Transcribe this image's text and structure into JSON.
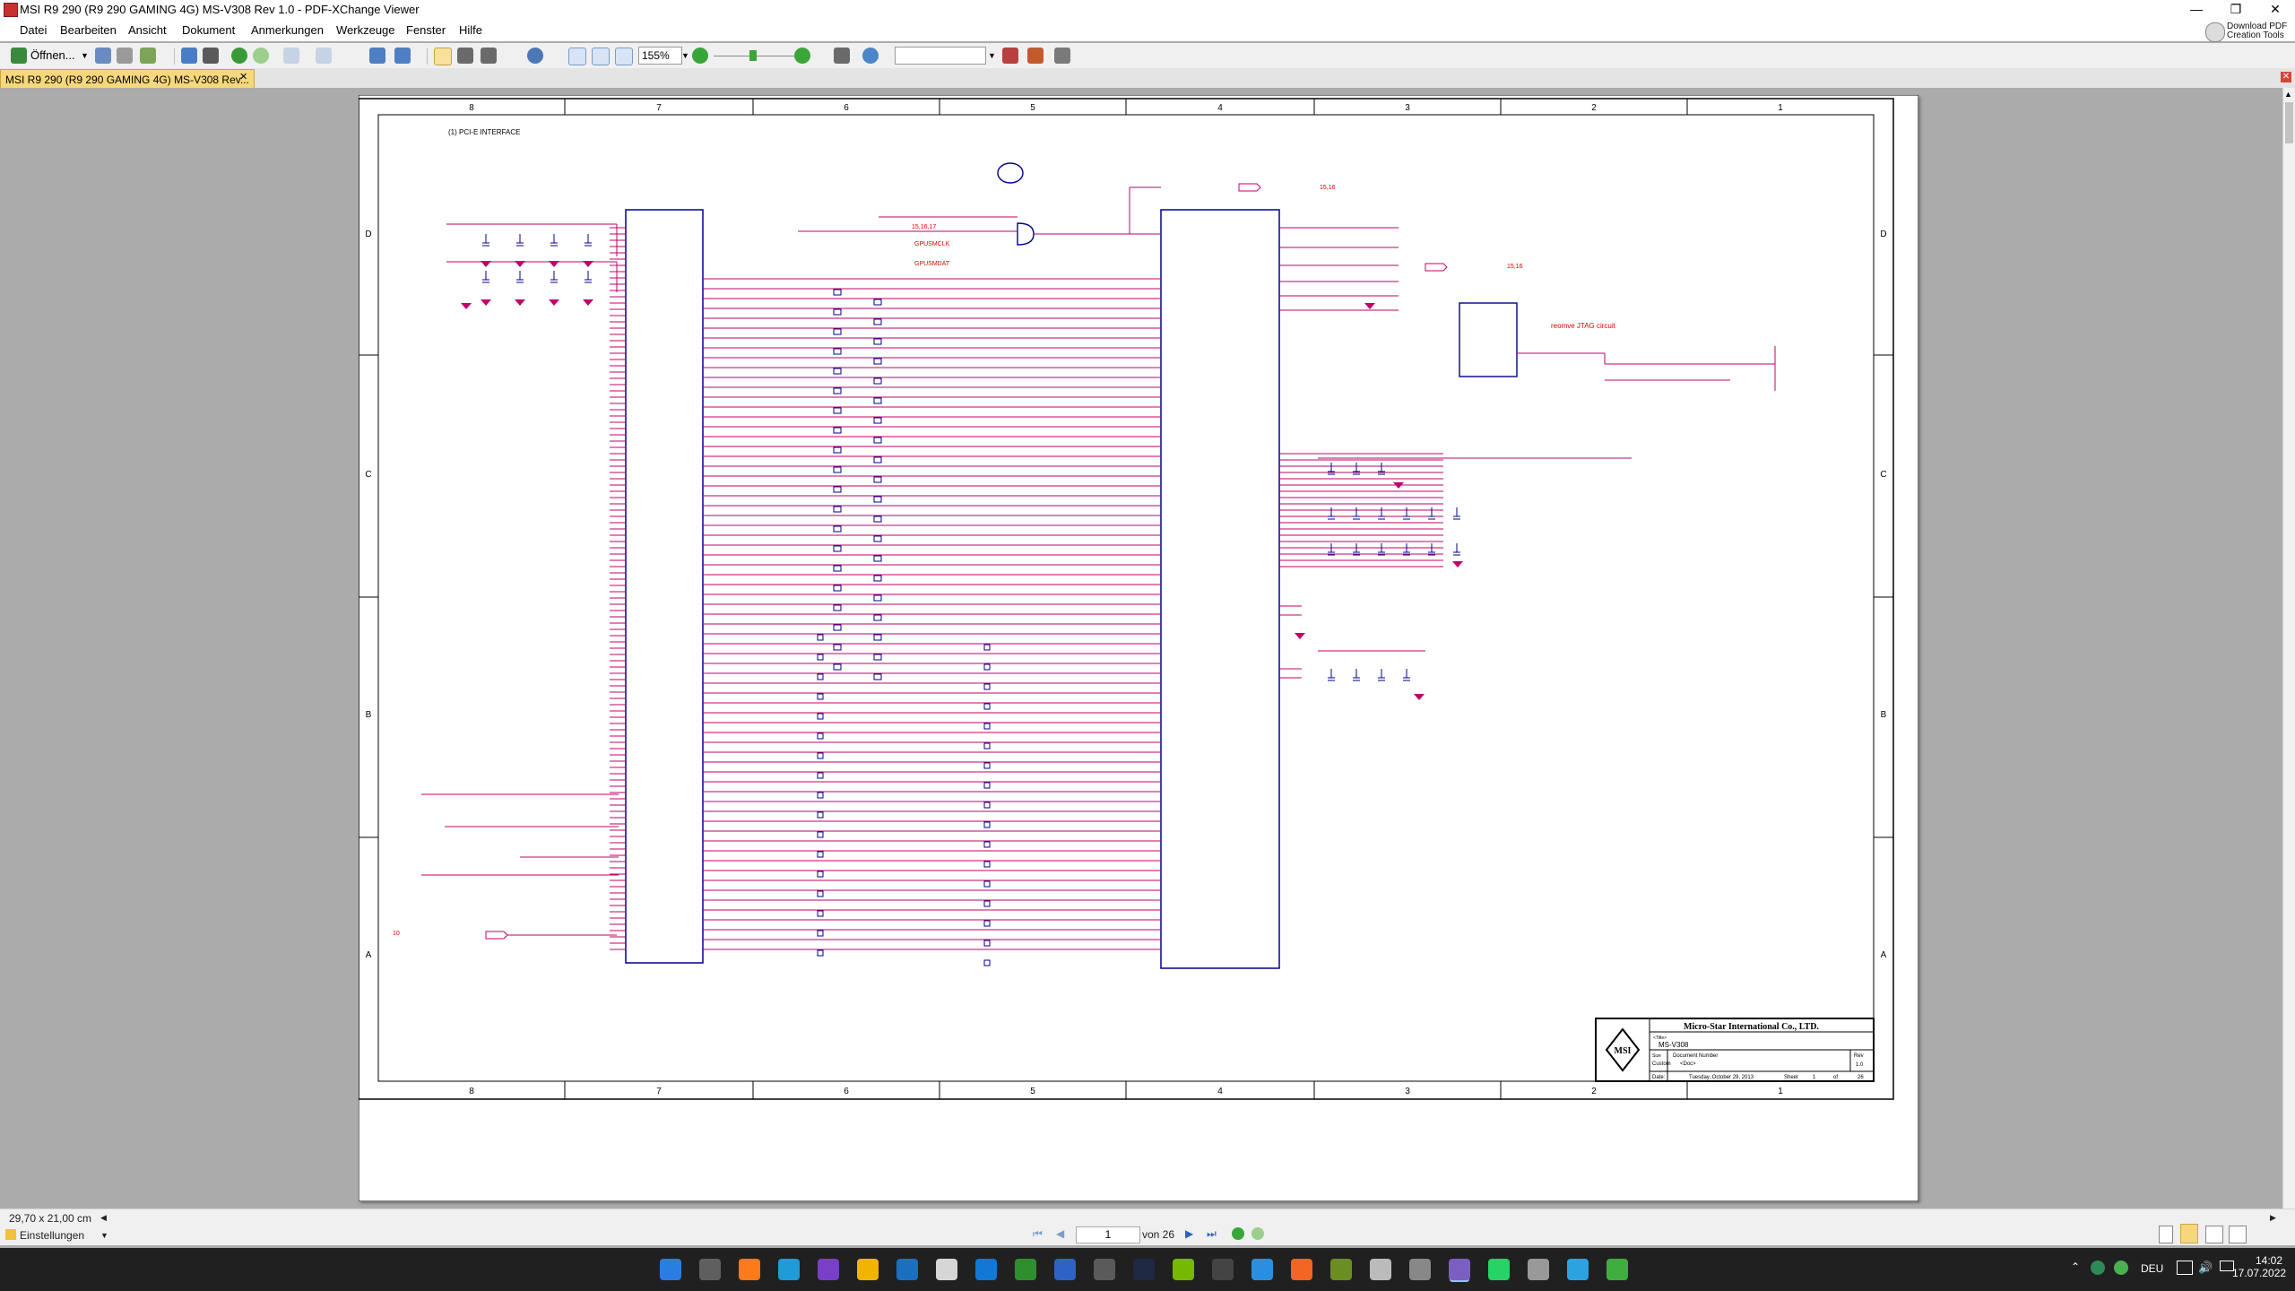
{
  "window": {
    "title": "MSI R9 290 (R9 290 GAMING 4G) MS-V308 Rev 1.0 - PDF-XChange Viewer",
    "controls": [
      "—",
      "❐",
      "✕"
    ]
  },
  "menu": [
    "Datei",
    "Bearbeiten",
    "Ansicht",
    "Dokument",
    "Anmerkungen",
    "Werkzeuge",
    "Fenster",
    "Hilfe"
  ],
  "download_pdf": {
    "line1": "Download PDF",
    "line2": "Creation Tools"
  },
  "toolbar": {
    "open_label": "Öffnen...",
    "zoom_value": "155%",
    "search_value": ""
  },
  "tab": {
    "label": "MSI R9 290 (R9 290 GAMING 4G) MS-V308 Rev..."
  },
  "status": {
    "page_size": "29,70 x 21,00 cm",
    "settings_label": "Einstellungen",
    "page_current": "1",
    "page_total": "von 26"
  },
  "schematic": {
    "columns": [
      "8",
      "7",
      "6",
      "5",
      "4",
      "3",
      "2",
      "1"
    ],
    "rows": [
      "D",
      "C",
      "B",
      "A"
    ],
    "section_title": "(1) PCI-E INTERFACE",
    "signals": {
      "gpusmclk": "GPUSMCLK",
      "gpusmdat": "GPUSMDAT",
      "remove_jtag": "reomve JTAG circuit"
    },
    "refs": {
      "r1": "15,16",
      "r2": "15,16",
      "r3": "10",
      "r4": "15,16,17"
    },
    "title_block": {
      "company": "Micro-Star International Co., LTD.",
      "logo": "MSI",
      "title_label": "<Title>",
      "title": "MS-V308",
      "size_label": "Size",
      "size": "Custom",
      "docnum_label": "Document Number",
      "docnum": "<Doc>",
      "rev_label": "Rev",
      "rev": "1.0",
      "date_label": "Date:",
      "date": "Tuesday, October 29, 2013",
      "sheet_label": "Sheet",
      "sheet": "1",
      "of": "of",
      "sheets": "26"
    }
  },
  "taskbar": {
    "lang": "DEU",
    "time": "14:02",
    "date": "17.07.2022",
    "icons": [
      "windows-start",
      "task-view",
      "firefox",
      "edge",
      "visual-studio",
      "file-explorer",
      "cortana",
      "notepad",
      "outlook",
      "xbox",
      "remote-desktop",
      "epic-games",
      "steam",
      "nvidia",
      "terminal",
      "mail",
      "origin",
      "minecraft",
      "inkscape",
      "network-tool",
      "pdf-xchange",
      "whatsapp",
      "utility",
      "telegram",
      "green-app"
    ]
  },
  "colors": {
    "accent": "#c8312f",
    "wire": "#c0006a",
    "component": "#00008b",
    "tab": "#f6d77b"
  }
}
